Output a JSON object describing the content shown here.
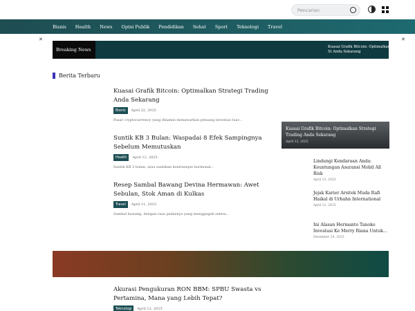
{
  "search": {
    "placeholder": "Pencarian"
  },
  "icons": {
    "search": "search-icon",
    "theme": "theme-toggle-icon",
    "grid": "grid-menu-icon",
    "close": "close-icon"
  },
  "nav": {
    "items": [
      "Bisnis",
      "Health",
      "News",
      "Opini Publik",
      "Pendidikan",
      "Sehat",
      "Sport",
      "Teknologi",
      "Travel"
    ]
  },
  "breaking": {
    "label": "Breaking News",
    "text": "Kuasai Grafik Bitcoin: Optimalkan St Anda Sekarang"
  },
  "section": {
    "title": "Berita Terbaru"
  },
  "articles": [
    {
      "title": "Kuasai Grafik Bitcoin: Optimalkan Strategi Trading Anda Sekarang",
      "category": "Bisnis",
      "date": "April 22, 2025",
      "excerpt": "Pasar cryptocurrency yang dinamis menawarkan peluang investasi luar..."
    },
    {
      "title": "Suntik KB 3 Bulan: Waspadai 8 Efek Sampingnya Sebelum Memutuskan",
      "category": "Health",
      "date": "April 12, 2025",
      "excerpt": "Suntik KB 3 bulan, atau suntikan kontrasepsi hormonal..."
    },
    {
      "title": "Resep Sambal Bawang Devina Hermawan: Awet Sebulan, Stok Aman di Kulkas",
      "category": "Travel",
      "date": "April 11, 2025",
      "excerpt": "Sambal bawang, dengan rasa pedasnya yang menggugah selera..."
    }
  ],
  "featured": {
    "title": "Kuasai Grafik Bitcoin: Optimalkan Strategi Trading Anda Sekarang",
    "date": "April 12, 2025"
  },
  "side_items": [
    {
      "title": "Lindungi Kendaraan Anda: Keuntungan Asuransi Mobil All Risk",
      "date": "April 12, 2025"
    },
    {
      "title": "Jejak Karier Arsitek Muda Rafi Haikal di Urbahn International",
      "date": "April 12, 2025"
    },
    {
      "title": "Ini Alasan Hermanto Tanoko Investasi Ke Merry Riana Untuk...",
      "date": "Desember 24, 2023"
    }
  ],
  "bottom_article": {
    "title": "Akurasi Pengukuran RON BBM: SPBU Swasta vs Pertamina, Mana yang Lebih Tepat?",
    "category": "Teknologi",
    "date": "April 12, 2025"
  },
  "colors": {
    "nav": "#1e5a5f",
    "badge": "#1d4f55",
    "section_accent": "#3b32b8",
    "breaking_bg": "#0f3a40"
  }
}
